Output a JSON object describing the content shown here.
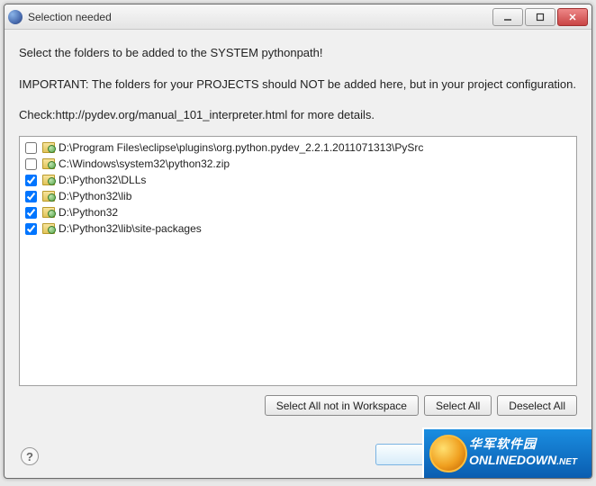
{
  "titlebar": {
    "title": "Selection needed"
  },
  "instructions": {
    "line1": "Select the folders to be added to the SYSTEM pythonpath!",
    "line2": "IMPORTANT: The folders for your PROJECTS should NOT be added here, but in your project configuration.",
    "line3": "Check:http://pydev.org/manual_101_interpreter.html for more details."
  },
  "folders": [
    {
      "checked": false,
      "path": "D:\\Program Files\\eclipse\\plugins\\org.python.pydev_2.2.1.2011071313\\PySrc"
    },
    {
      "checked": false,
      "path": "C:\\Windows\\system32\\python32.zip"
    },
    {
      "checked": true,
      "path": "D:\\Python32\\DLLs"
    },
    {
      "checked": true,
      "path": "D:\\Python32\\lib"
    },
    {
      "checked": true,
      "path": "D:\\Python32"
    },
    {
      "checked": true,
      "path": "D:\\Python32\\lib\\site-packages"
    }
  ],
  "buttons": {
    "select_all_not_in_workspace": "Select All not in Workspace",
    "select_all": "Select All",
    "deselect_all": "Deselect All"
  },
  "watermark": {
    "cn": "华军软件园",
    "brand": "ONLINEDOWN",
    "suffix": ".NET"
  }
}
